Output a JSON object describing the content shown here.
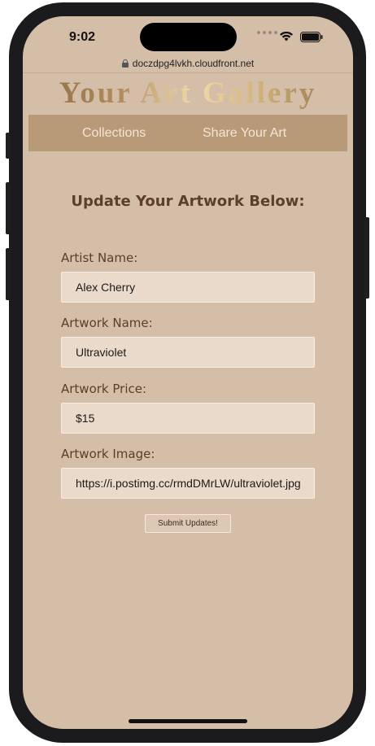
{
  "status_bar": {
    "time": "9:02",
    "icons": [
      "signal-dots-icon",
      "wifi-icon",
      "battery-icon"
    ]
  },
  "browser": {
    "url": "doczdpg4lvkh.cloudfront.net",
    "lock_icon": "lock-icon"
  },
  "site": {
    "title": "Your Art Gallery",
    "nav": {
      "collections": "Collections",
      "share": "Share Your Art"
    }
  },
  "form": {
    "heading": "Update Your Artwork Below:",
    "fields": [
      {
        "label": "Artist Name:",
        "value": "Alex Cherry"
      },
      {
        "label": "Artwork Name:",
        "value": "Ultraviolet"
      },
      {
        "label": "Artwork Price:",
        "value": "$15"
      },
      {
        "label": "Artwork Image:",
        "value": "https://i.postimg.cc/rmdDMrLW/ultraviolet.jpg"
      }
    ],
    "submit_label": "Submit Updates!"
  },
  "colors": {
    "page_background": "#d5bea8",
    "nav_background": "#b99a78",
    "heading_text": "#5b3f2a",
    "input_background": "#eadacb"
  }
}
